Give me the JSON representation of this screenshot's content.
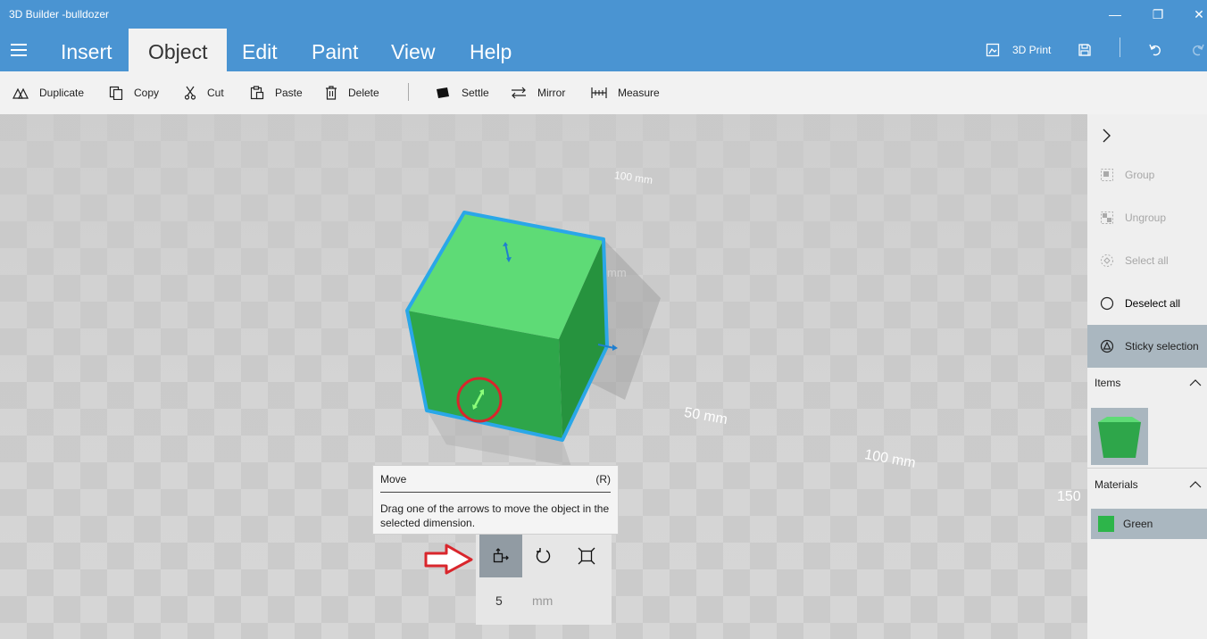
{
  "window": {
    "title": "3D Builder -bulldozer",
    "minimize_glyph": "—",
    "maximize_glyph": "❐",
    "close_glyph": "✕"
  },
  "menu": {
    "items": [
      {
        "label": "Insert"
      },
      {
        "label": "Object",
        "active": true
      },
      {
        "label": "Edit"
      },
      {
        "label": "Paint"
      },
      {
        "label": "View"
      },
      {
        "label": "Help"
      }
    ],
    "print_label": "3D Print"
  },
  "toolbar": {
    "duplicate": "Duplicate",
    "copy": "Copy",
    "cut": "Cut",
    "paste": "Paste",
    "delete": "Delete",
    "settle": "Settle",
    "mirror": "Mirror",
    "measure": "Measure"
  },
  "viewport": {
    "dim_labels": [
      "100 mm",
      "mm",
      "50 mm",
      "100 mm",
      "150"
    ],
    "object_color": "#3db54a",
    "selection_color": "#2aa7e8",
    "annotation_color": "#d9262c"
  },
  "tooltip": {
    "title": "Move",
    "shortcut": "(R)",
    "description": "Drag one of the arrows to move the object in the selected dimension."
  },
  "transform": {
    "active_mode": "move",
    "step_value": "5",
    "step_unit": "mm"
  },
  "sidepanel": {
    "group": "Group",
    "ungroup": "Ungroup",
    "select_all": "Select all",
    "deselect_all": "Deselect all",
    "sticky_selection": "Sticky selection",
    "items_header": "Items",
    "materials_header": "Materials",
    "material_name": "Green",
    "material_color": "#2db54a"
  }
}
